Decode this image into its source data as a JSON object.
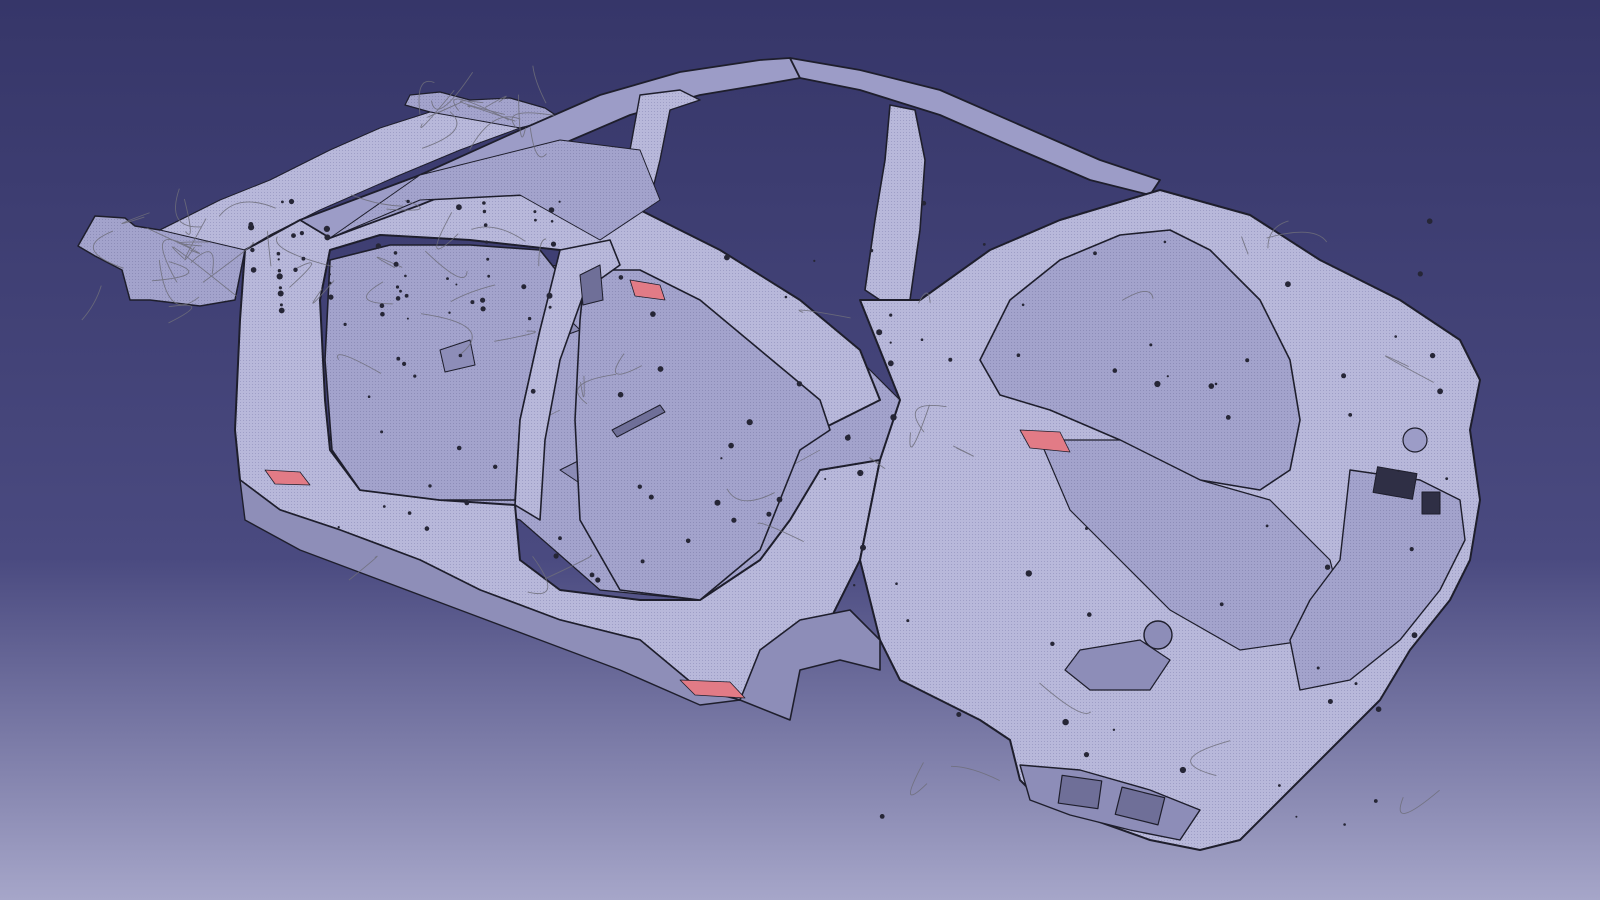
{
  "app": {
    "viewer": "3d-cad-viewport",
    "model": "car-body-in-white"
  },
  "background": {
    "top_color": "#363669",
    "mid_color": "#4a4a80",
    "bottom_color": "#a6a6c9"
  },
  "body": {
    "surface_color": "#9c9cc7",
    "surface_light": "#b3b3d6",
    "edge_color": "#1e1e2c",
    "edge_soft": "#6e6e7a",
    "highlight_color": "#e27b86",
    "hole_color": "#262636"
  }
}
